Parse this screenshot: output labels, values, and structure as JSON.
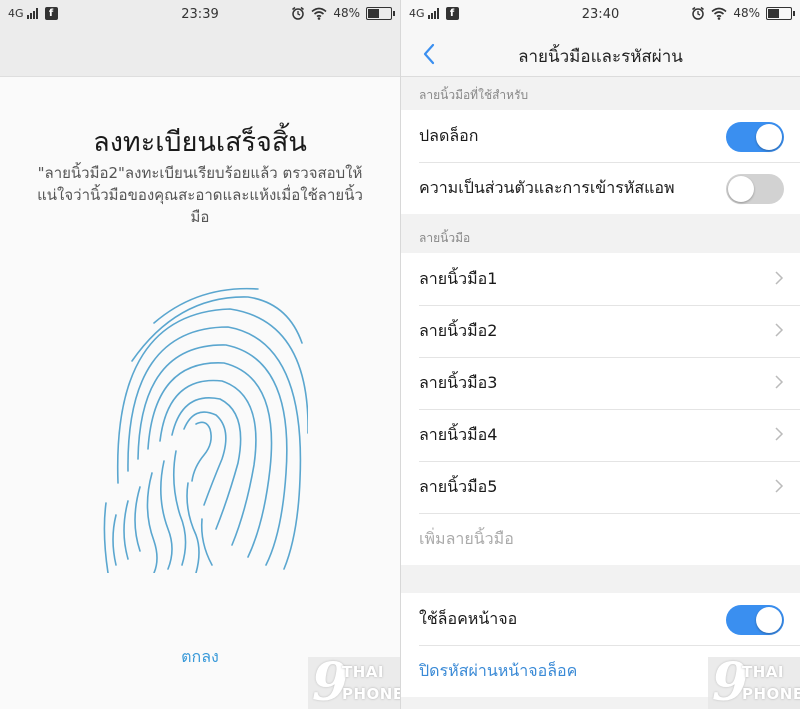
{
  "left": {
    "status": {
      "network": "4G",
      "time": "23:39",
      "battery": "48%"
    },
    "enroll_title": "ลงทะเบียนเสร็จสิ้น",
    "enroll_message": "\"ลายนิ้วมือ2\"ลงทะเบียนเรียบร้อยแล้ว ตรวจสอบให้แน่ใจว่านิ้วมือของคุณสะอาดและแห้งเมื่อใช้ลายนิ้วมือ",
    "ok_label": "ตกลง",
    "fingerprint_color": "#5aa6cf"
  },
  "right": {
    "status": {
      "network": "4G",
      "time": "23:40",
      "battery": "48%"
    },
    "nav_title": "ลายนิ้วมือและรหัสผ่าน",
    "use_section": {
      "header": "ลายนิ้วมือที่ใช้สำหรับ",
      "unlock_label": "ปลดล็อก",
      "unlock_on": true,
      "privacy_label": "ความเป็นส่วนตัวและการเข้ารหัสแอพ",
      "privacy_on": false
    },
    "fingerprints_section": {
      "header": "ลายนิ้วมือ",
      "items": [
        "ลายนิ้วมือ1",
        "ลายนิ้วมือ2",
        "ลายนิ้วมือ3",
        "ลายนิ้วมือ4",
        "ลายนิ้วมือ5"
      ],
      "add_label": "เพิ่มลายนิ้วมือ"
    },
    "lock_screen": {
      "use_label": "ใช้ล็อคหน้าจอ",
      "use_on": true,
      "disable_password_label": "ปิดรหัสผ่านหน้าจอล็อค"
    }
  },
  "watermark": {
    "digit": "9",
    "word1": "THAI",
    "word2": "PHONE"
  },
  "colors": {
    "accent": "#3a8ff0",
    "link": "#3a8ad6",
    "toggle_off": "#d2d2d2"
  }
}
